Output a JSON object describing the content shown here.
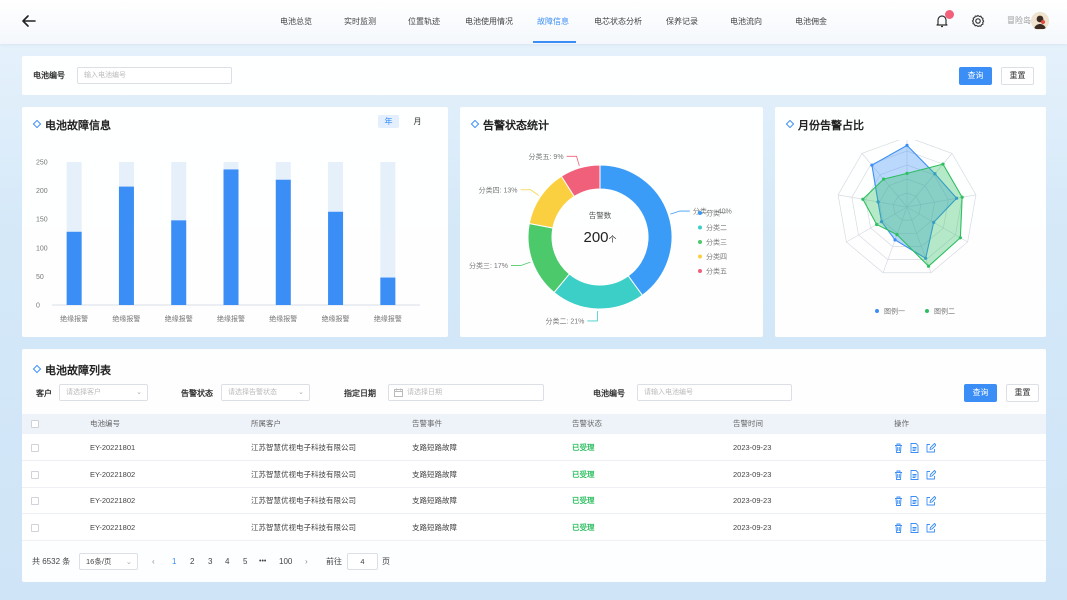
{
  "nav": {
    "items": [
      {
        "label": "电池总览"
      },
      {
        "label": "实时监测"
      },
      {
        "label": "位置轨迹"
      },
      {
        "label": "电池使用情况"
      },
      {
        "label": "故障信息"
      },
      {
        "label": "电芯状态分析"
      },
      {
        "label": "保养记录"
      },
      {
        "label": "电池流向"
      },
      {
        "label": "电池佣金"
      }
    ],
    "active_index": 4,
    "user_name": "冒险岛"
  },
  "search_bar": {
    "label": "电池编号",
    "placeholder": "输入电池编号",
    "query_label": "查询",
    "reset_label": "重置"
  },
  "fault_panel": {
    "title": "电池故障信息",
    "toggle_year": "年",
    "toggle_month": "月"
  },
  "alarm_panel": {
    "title": "告警状态统计",
    "center_label": "告警数",
    "center_value": "200",
    "center_unit": "个"
  },
  "radar_panel": {
    "title": "月份告警占比"
  },
  "chart_data": [
    {
      "type": "bar",
      "categories": [
        "绝缘报警",
        "绝缘报警",
        "绝缘报警",
        "绝缘报警",
        "绝缘报警",
        "绝缘报警",
        "绝缘报警"
      ],
      "values": [
        128,
        207,
        148,
        237,
        219,
        163,
        48
      ],
      "ylim": [
        0,
        250
      ],
      "yticks": [
        0,
        50,
        100,
        150,
        200,
        250
      ],
      "background_max": 250,
      "bar_color": "#3a8ef6",
      "bg_color": "#e6f0fb"
    },
    {
      "type": "pie",
      "categories": [
        "分类一",
        "分类二",
        "分类三",
        "分类四",
        "分类五"
      ],
      "values": [
        40,
        21,
        17,
        13,
        9
      ],
      "slice_labels": [
        "分类一: 40%",
        "分类二: 21%",
        "分类三: 17%",
        "分类四: 13%",
        "分类五: 9%"
      ],
      "colors": [
        "#3a9cf7",
        "#3ccfc8",
        "#4cc96a",
        "#fbd040",
        "#f0607a"
      ],
      "legend": [
        "分类一",
        "分类二",
        "分类三",
        "分类四",
        "分类五"
      ]
    },
    {
      "type": "radar",
      "axes": 9,
      "max": 100,
      "series": [
        {
          "name": "图例一",
          "color": "#3a8ef6",
          "values": [
            88,
            62,
            72,
            44,
            78,
            50,
            42,
            42,
            78
          ]
        },
        {
          "name": "图例二",
          "color": "#2fbf62",
          "values": [
            48,
            80,
            80,
            88,
            90,
            42,
            50,
            64,
            52
          ]
        }
      ]
    }
  ],
  "list": {
    "title": "电池故障列表",
    "filters": {
      "customer_label": "客户",
      "customer_placeholder": "请选择客户",
      "status_label": "告警状态",
      "status_placeholder": "请选择告警状态",
      "date_label": "指定日期",
      "date_placeholder": "请选择日期",
      "battery_label": "电池编号",
      "battery_placeholder": "请输入电池编号",
      "query_label": "查询",
      "reset_label": "重置"
    },
    "columns": [
      "电池编号",
      "所属客户",
      "告警事件",
      "告警状态",
      "告警时间",
      "操作"
    ],
    "rows": [
      {
        "id": "EY-20221801",
        "customer": "江苏智慧优视电子科技有限公司",
        "event": "支路短路故障",
        "status": "已受理",
        "time": "2023-09-23"
      },
      {
        "id": "EY-20221802",
        "customer": "江苏智慧优视电子科技有限公司",
        "event": "支路短路故障",
        "status": "已受理",
        "time": "2023-09-23"
      },
      {
        "id": "EY-20221802",
        "customer": "江苏智慧优视电子科技有限公司",
        "event": "支路短路故障",
        "status": "已受理",
        "time": "2023-09-23"
      },
      {
        "id": "EY-20221802",
        "customer": "江苏智慧优视电子科技有限公司",
        "event": "支路短路故障",
        "status": "已受理",
        "time": "2023-09-23"
      }
    ],
    "status_color": "#2fbf62"
  },
  "pagination": {
    "total": "共 6532 条",
    "page_size": "16条/页",
    "pages": [
      "1",
      "2",
      "3",
      "4",
      "5",
      "•••",
      "100"
    ],
    "current": "1",
    "goto_label": "前往",
    "goto_value": "4",
    "page_suffix": "页"
  }
}
